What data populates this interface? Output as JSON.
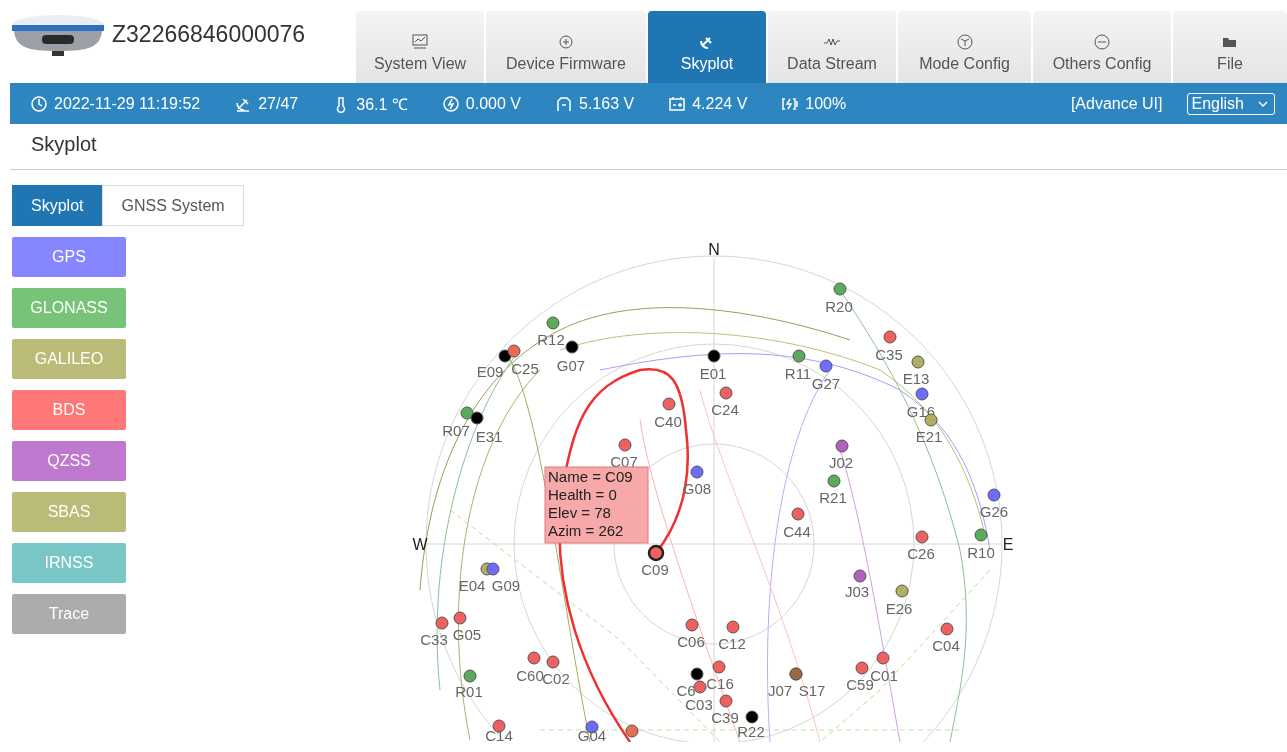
{
  "device": {
    "serial": "Z32266846000076"
  },
  "tabs": [
    {
      "label": "System View",
      "selected": false
    },
    {
      "label": "Device Firmware",
      "selected": false
    },
    {
      "label": "Skyplot",
      "selected": true
    },
    {
      "label": "Data Stream",
      "selected": false
    },
    {
      "label": "Mode Config",
      "selected": false
    },
    {
      "label": "Others Config",
      "selected": false
    },
    {
      "label": "File",
      "selected": false
    }
  ],
  "status_bar": {
    "items": [
      {
        "kind": "clock",
        "text": "2022-11-29 11:19:52"
      },
      {
        "kind": "satellite",
        "text": "27/47"
      },
      {
        "kind": "temperature",
        "text": "36.1 ℃"
      },
      {
        "kind": "gauge",
        "text": "0.000 V"
      },
      {
        "kind": "plug",
        "text": "5.163 V"
      },
      {
        "kind": "battery",
        "text": "4.224 V"
      },
      {
        "kind": "charge",
        "text": "100%"
      }
    ],
    "advance_link": "[Advance UI]",
    "language": "English"
  },
  "page_title": "Skyplot",
  "view_tabs": [
    {
      "label": "Skyplot",
      "selected": true
    },
    {
      "label": "GNSS System",
      "selected": false
    }
  ],
  "legend": [
    {
      "label": "GPS",
      "color": "#8080ff"
    },
    {
      "label": "GLONASS",
      "color": "#70c070"
    },
    {
      "label": "GALILEO",
      "color": "#b8b872"
    },
    {
      "label": "BDS",
      "color": "#ff7070"
    },
    {
      "label": "QZSS",
      "color": "#bb72cc"
    },
    {
      "label": "SBAS",
      "color": "#b8b872"
    },
    {
      "label": "IRNSS",
      "color": "#72c4c4"
    },
    {
      "label": "Trace",
      "color": "#a8a8a8"
    }
  ],
  "skyplot": {
    "directions": [
      {
        "kind": "n",
        "text": "N"
      },
      {
        "kind": "w",
        "text": "W"
      },
      {
        "kind": "e",
        "text": "E"
      }
    ],
    "satellites": [
      {
        "label": "R20",
        "color": "#5aac5a",
        "selected": false
      },
      {
        "label": "R12",
        "color": "#5aac5a",
        "selected": false
      },
      {
        "label": "E09",
        "color": "#000000",
        "selected": false
      },
      {
        "label": "C25",
        "color": "#f06a50",
        "selected": false
      },
      {
        "label": "G07",
        "color": "#000000",
        "selected": false
      },
      {
        "label": "E01",
        "color": "#000000",
        "selected": false
      },
      {
        "label": "R11",
        "color": "#5aac5a",
        "selected": false
      },
      {
        "label": "G27",
        "color": "#6c6cff",
        "selected": false
      },
      {
        "label": "C35",
        "color": "#f06060",
        "selected": false
      },
      {
        "label": "E13",
        "color": "#b0b060",
        "selected": false
      },
      {
        "label": "G16",
        "color": "#6c6cff",
        "selected": false
      },
      {
        "label": "E21",
        "color": "#b0b060",
        "selected": false
      },
      {
        "label": "C24",
        "color": "#f06060",
        "selected": false
      },
      {
        "label": "C40",
        "color": "#f06060",
        "selected": false
      },
      {
        "label": "R07",
        "color": "#5aac5a",
        "selected": false
      },
      {
        "label": "E31",
        "color": "#000000",
        "selected": false
      },
      {
        "label": "C07",
        "color": "#f06060",
        "selected": false
      },
      {
        "label": "J02",
        "color": "#b060c0",
        "selected": false
      },
      {
        "label": "G08",
        "color": "#6c6cff",
        "selected": false
      },
      {
        "label": "R21",
        "color": "#5aac5a",
        "selected": false
      },
      {
        "label": "G26",
        "color": "#6c6cff",
        "selected": false
      },
      {
        "label": "C44",
        "color": "#f06060",
        "selected": false
      },
      {
        "label": "C26",
        "color": "#f06060",
        "selected": false
      },
      {
        "label": "R10",
        "color": "#5aac5a",
        "selected": false
      },
      {
        "label": "C09",
        "color": "#f06060",
        "selected": true
      },
      {
        "label": "E04",
        "color": "#b0b060",
        "selected": false
      },
      {
        "label": "G09",
        "color": "#6c6cff",
        "selected": false
      },
      {
        "label": "J03",
        "color": "#b060c0",
        "selected": false
      },
      {
        "label": "E26",
        "color": "#b0b060",
        "selected": false
      },
      {
        "label": "C33",
        "color": "#f06060",
        "selected": false
      },
      {
        "label": "G05",
        "color": "#f06060",
        "selected": false
      },
      {
        "label": "C06",
        "color": "#f06060",
        "selected": false
      },
      {
        "label": "C12",
        "color": "#f06060",
        "selected": false
      },
      {
        "label": "C04",
        "color": "#f06060",
        "selected": false
      },
      {
        "label": "C60",
        "color": "#f06060",
        "selected": false
      },
      {
        "label": "C02",
        "color": "#f06060",
        "selected": false
      },
      {
        "label": "C01",
        "color": "#f06060",
        "selected": false
      },
      {
        "label": "C59",
        "color": "#f06060",
        "selected": false
      },
      {
        "label": "R01",
        "color": "#5aac5a",
        "selected": false
      },
      {
        "label": "C16",
        "color": "#f06060",
        "selected": false
      },
      {
        "label": "C6",
        "color": "#000000",
        "selected": false
      },
      {
        "label": "C03",
        "color": "#f06060",
        "selected": false
      },
      {
        "label": "J07",
        "color": "#9a6a40",
        "selected": false
      },
      {
        "label": "S17",
        "color": "#9a6a40",
        "selected": false
      },
      {
        "label": "C39",
        "color": "#f06060",
        "selected": false
      },
      {
        "label": "R22",
        "color": "#000000",
        "selected": false
      },
      {
        "label": "C14",
        "color": "#f06060",
        "selected": false
      },
      {
        "label": "G04",
        "color": "#6c6cff",
        "selected": false
      },
      {
        "color": "#e07050",
        "selected": false
      }
    ],
    "tooltip": [
      "Name = C09",
      "Health = 0",
      "Elev = 78",
      "Azim = 262"
    ]
  }
}
